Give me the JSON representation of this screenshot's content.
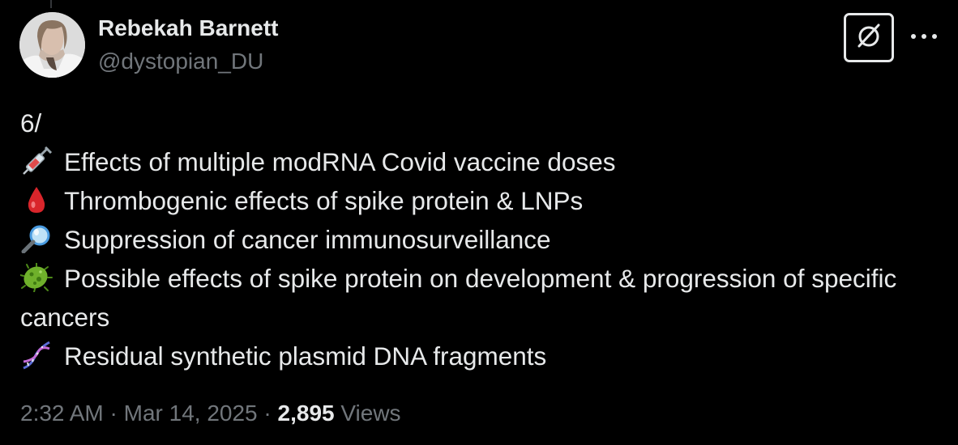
{
  "author": {
    "name": "Rebekah Barnett",
    "handle": "@dystopian_DU"
  },
  "header": {
    "grok_icon": "grok-slash-circle-icon",
    "more_icon": "ellipsis-icon",
    "more_label": "···"
  },
  "tweet": {
    "number": "6/",
    "items": [
      {
        "icon": "syringe-icon",
        "text": "Effects of multiple modRNA Covid vaccine doses"
      },
      {
        "icon": "drop-of-blood-icon",
        "text": "Thrombogenic effects of spike protein & LNPs"
      },
      {
        "icon": "magnifying-glass-icon",
        "text": "Suppression of cancer immunosurveillance"
      },
      {
        "icon": "microbe-icon",
        "text": "Possible effects of spike protein on development & progression of specific cancers"
      },
      {
        "icon": "dna-icon",
        "text": "Residual synthetic plasmid DNA fragments"
      }
    ]
  },
  "meta": {
    "time": "2:32 AM",
    "separator": "·",
    "date": "Mar 14, 2025",
    "views_count": "2,895",
    "views_label": "Views"
  },
  "colors": {
    "background": "#000000",
    "primary_text": "#e7e9ea",
    "secondary_text": "#71767b",
    "blood_red": "#d9252b",
    "microbe_green": "#6fb02b",
    "magnifier_blue": "#4a9be0"
  }
}
